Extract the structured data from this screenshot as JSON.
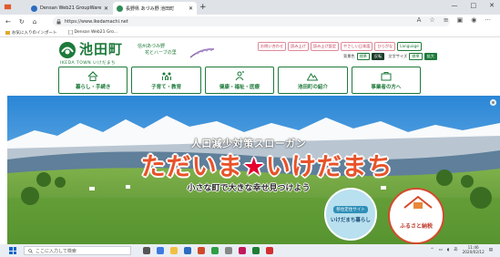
{
  "browser": {
    "tabs": [
      {
        "title": "Densan Web21 GroupWare v4.1.8",
        "favicon_color": "#2d6cc0"
      },
      {
        "title": "長野県 あづみ野 池田町",
        "favicon_color": "#2e8b57"
      }
    ],
    "new_tab": "+",
    "window_controls": [
      "—",
      "□",
      "✕"
    ],
    "url": "https://www.ikedamachi.net",
    "favorites": [
      {
        "label": "お気に入りのインポート"
      },
      {
        "label": "Densan Web21 Gro..."
      }
    ]
  },
  "site": {
    "logo_text": "池田町",
    "logo_sub": "IKEDA TOWN いけだまち",
    "tagline_line1": "信州あづみ野",
    "tagline_line2": "花とハーブの里",
    "utility_links": [
      "お問い合わせ",
      "読み上げ",
      "読み上げ設定",
      "やさしい日本語",
      "ひらがな",
      "Language"
    ],
    "display": {
      "bg_label": "背景色",
      "bg_options": [
        "標準",
        "反転"
      ],
      "size_label": "文字サイズ",
      "size_options": [
        "標準",
        "拡大"
      ]
    },
    "nav": [
      {
        "label": "暮らし・手続き",
        "icon": "house-icon"
      },
      {
        "label": "子育て・教育",
        "icon": "family-icon"
      },
      {
        "label": "健康・福祉・医療",
        "icon": "health-icon"
      },
      {
        "label": "池田町の紹介",
        "icon": "mountain-icon"
      },
      {
        "label": "事業者の方へ",
        "icon": "briefcase-icon"
      }
    ],
    "hero": {
      "slogan_title": "人口減少対策スローガン",
      "slogan_main_pre": "ただいま",
      "slogan_star": "★",
      "slogan_main_post": "いけだまち",
      "slogan_sub": "小さな町で大きな幸せ見つけよう",
      "badge_live_top": "移住定住サイト",
      "badge_live_bottom": "いけだまち暮らし",
      "badge_tax": "ふるさと納税"
    }
  },
  "taskbar": {
    "search_placeholder": "ここに入力して検索",
    "time": "11:46",
    "date": "2020/02/12",
    "ime": "あ",
    "app_colors": [
      "#555",
      "#3d7be0",
      "#f0c040",
      "#2d6cc0",
      "#d04a2a",
      "#2f9e44",
      "#888",
      "#c2185b",
      "#1e7e34",
      "#d32f2f"
    ]
  },
  "colors": {
    "brand_green": "#1d7a3a",
    "slogan_orange": "#e8532a",
    "accent_pink": "#c23b57"
  }
}
